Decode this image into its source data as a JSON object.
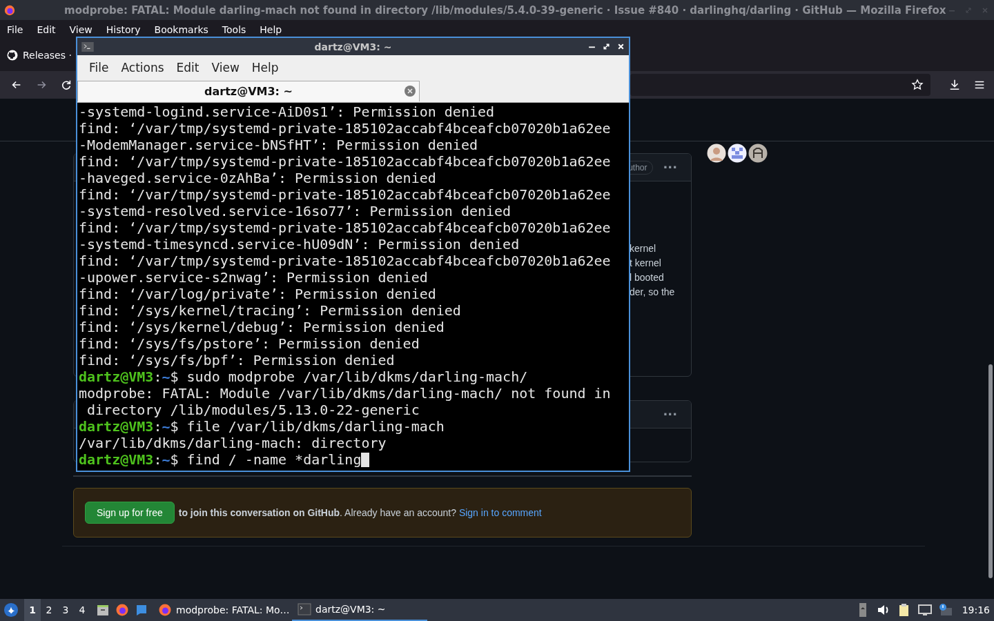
{
  "browser": {
    "title": "modprobe: FATAL: Module darling-mach not found in directory /lib/modules/5.4.0-39-generic · Issue #840 · darlinghq/darling · GitHub — Mozilla Firefox",
    "menu": [
      "File",
      "Edit",
      "View",
      "History",
      "Bookmarks",
      "Tools",
      "Help"
    ],
    "tabs": [
      {
        "label": "Releases ·",
        "selected": false
      }
    ]
  },
  "page": {
    "comments": [
      {
        "badge": "uthor",
        "menu": "···",
        "lines": [
          "kernel",
          "t kernel",
          "l booted",
          "der, so the"
        ]
      },
      {
        "menu": "···"
      }
    ],
    "banner": {
      "button": "Sign up for free",
      "text": "to join this conversation on GitHub",
      "rest": ". Already have an account?",
      "link": "Sign in to comment"
    }
  },
  "terminal": {
    "title": "dartz@VM3: ~",
    "menu": [
      "File",
      "Actions",
      "Edit",
      "View",
      "Help"
    ],
    "tab": "dartz@VM3: ~",
    "lines": [
      {
        "kind": "output",
        "text": "-systemd-logind.service-AiD0s1’: Permission denied"
      },
      {
        "kind": "output",
        "text": "find: ‘/var/tmp/systemd-private-185102accabf4bceafcb07020b1a62ee"
      },
      {
        "kind": "output",
        "text": "-ModemManager.service-bNSfHT’: Permission denied"
      },
      {
        "kind": "output",
        "text": "find: ‘/var/tmp/systemd-private-185102accabf4bceafcb07020b1a62ee"
      },
      {
        "kind": "output",
        "text": "-haveged.service-0zAhBa’: Permission denied"
      },
      {
        "kind": "output",
        "text": "find: ‘/var/tmp/systemd-private-185102accabf4bceafcb07020b1a62ee"
      },
      {
        "kind": "output",
        "text": "-systemd-resolved.service-16so77’: Permission denied"
      },
      {
        "kind": "output",
        "text": "find: ‘/var/tmp/systemd-private-185102accabf4bceafcb07020b1a62ee"
      },
      {
        "kind": "output",
        "text": "-systemd-timesyncd.service-hU09dN’: Permission denied"
      },
      {
        "kind": "output",
        "text": "find: ‘/var/tmp/systemd-private-185102accabf4bceafcb07020b1a62ee"
      },
      {
        "kind": "output",
        "text": "-upower.service-s2nwag’: Permission denied"
      },
      {
        "kind": "output",
        "text": "find: ‘/var/log/private’: Permission denied"
      },
      {
        "kind": "output",
        "text": "find: ‘/sys/kernel/tracing’: Permission denied"
      },
      {
        "kind": "output",
        "text": "find: ‘/sys/kernel/debug’: Permission denied"
      },
      {
        "kind": "output",
        "text": "find: ‘/sys/fs/pstore’: Permission denied"
      },
      {
        "kind": "output",
        "text": "find: ‘/sys/fs/bpf’: Permission denied"
      },
      {
        "kind": "prompt",
        "host": "dartz@VM3",
        "sep": ":",
        "path": "~",
        "symbol": "$",
        "command": "sudo modprobe /var/lib/dkms/darling-mach/",
        "cursor": false
      },
      {
        "kind": "output",
        "text": "modprobe: FATAL: Module /var/lib/dkms/darling-mach/ not found in"
      },
      {
        "kind": "output",
        "text": " directory /lib/modules/5.13.0-22-generic"
      },
      {
        "kind": "prompt",
        "host": "dartz@VM3",
        "sep": ":",
        "path": "~",
        "symbol": "$",
        "command": "file /var/lib/dkms/darling-mach",
        "cursor": false
      },
      {
        "kind": "output",
        "text": "/var/lib/dkms/darling-mach: directory"
      },
      {
        "kind": "prompt",
        "host": "dartz@VM3",
        "sep": ":",
        "path": "~",
        "symbol": "$",
        "command": "find / -name *darling",
        "cursor": true
      }
    ]
  },
  "taskbar": {
    "workspaces": [
      {
        "label": "1",
        "selected": true
      },
      {
        "label": "2",
        "selected": false
      },
      {
        "label": "3",
        "selected": false
      },
      {
        "label": "4",
        "selected": false
      }
    ],
    "tasks": [
      {
        "kind": "browser",
        "label": "modprobe: FATAL: Mo…",
        "selected": false
      },
      {
        "kind": "terminal",
        "label": "dartz@VM3: ~",
        "selected": true
      }
    ],
    "clock": "19:16"
  }
}
